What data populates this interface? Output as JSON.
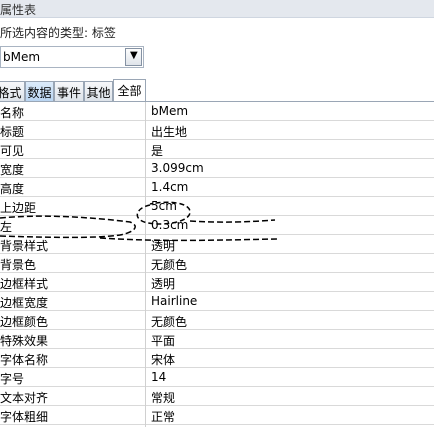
{
  "panel": {
    "title": "属性表",
    "selection_label": "所选内容的类型: 标签",
    "selected_object": "bMem"
  },
  "tabs": [
    {
      "label": "格式"
    },
    {
      "label": "数据"
    },
    {
      "label": "事件"
    },
    {
      "label": "其他"
    },
    {
      "label": "全部"
    }
  ],
  "properties": [
    {
      "name": "名称",
      "value": "bMem"
    },
    {
      "name": "标题",
      "value": "出生地"
    },
    {
      "name": "可见",
      "value": "是"
    },
    {
      "name": "宽度",
      "value": "3.099cm"
    },
    {
      "name": "高度",
      "value": "1.4cm"
    },
    {
      "name": "上边距",
      "value": "5cm"
    },
    {
      "name": "左",
      "value": "0.3cm"
    },
    {
      "name": "背景样式",
      "value": "透明"
    },
    {
      "name": "背景色",
      "value": "无颜色"
    },
    {
      "name": "边框样式",
      "value": "透明"
    },
    {
      "name": "边框宽度",
      "value": "Hairline"
    },
    {
      "name": "边框颜色",
      "value": "无颜色"
    },
    {
      "name": "特殊效果",
      "value": "平面"
    },
    {
      "name": "字体名称",
      "value": "宋体"
    },
    {
      "name": "字号",
      "value": "14"
    },
    {
      "name": "文本对齐",
      "value": "常规"
    },
    {
      "name": "字体粗细",
      "value": "正常"
    }
  ],
  "colors": {
    "title_bg": "#e4e8ee",
    "grid_line": "#d9d9d9",
    "annotation": "#000000"
  }
}
